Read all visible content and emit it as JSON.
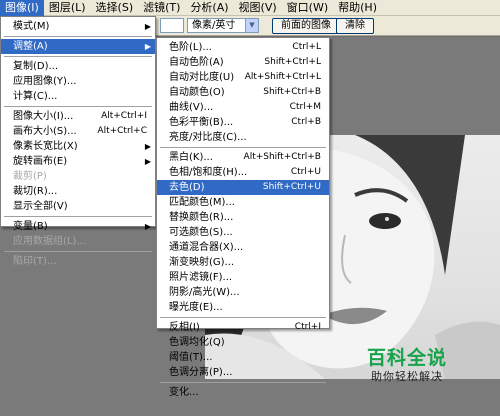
{
  "menubar": {
    "items": [
      "图像(I)",
      "图层(L)",
      "选择(S)",
      "滤镜(T)",
      "分析(A)",
      "视图(V)",
      "窗口(W)",
      "帮助(H)"
    ]
  },
  "options_bar": {
    "unit_select": "像素/英寸",
    "front_image_button": "前面的图像",
    "clear_button": "清除"
  },
  "image_menu": {
    "items": [
      {
        "label": "模式(M)",
        "submenu": true
      },
      {
        "label": "调整(A)",
        "submenu": true,
        "active": true
      },
      {
        "label": "复制(D)..."
      },
      {
        "label": "应用图像(Y)..."
      },
      {
        "label": "计算(C)..."
      },
      {
        "label": "图像大小(I)...",
        "shortcut": "Alt+Ctrl+I"
      },
      {
        "label": "画布大小(S)...",
        "shortcut": "Alt+Ctrl+C"
      },
      {
        "label": "像素长宽比(X)",
        "submenu": true
      },
      {
        "label": "旋转画布(E)",
        "submenu": true
      },
      {
        "label": "裁剪(P)",
        "disabled": true
      },
      {
        "label": "裁切(R)..."
      },
      {
        "label": "显示全部(V)"
      },
      {
        "label": "变量(B)",
        "submenu": true
      },
      {
        "label": "应用数据组(L)...",
        "disabled": true
      },
      {
        "label": "陷印(T)...",
        "disabled": true
      }
    ]
  },
  "adjust_submenu": {
    "items": [
      {
        "label": "色阶(L)...",
        "shortcut": "Ctrl+L"
      },
      {
        "label": "自动色阶(A)",
        "shortcut": "Shift+Ctrl+L"
      },
      {
        "label": "自动对比度(U)",
        "shortcut": "Alt+Shift+Ctrl+L"
      },
      {
        "label": "自动颜色(O)",
        "shortcut": "Shift+Ctrl+B"
      },
      {
        "label": "曲线(V)...",
        "shortcut": "Ctrl+M"
      },
      {
        "label": "色彩平衡(B)...",
        "shortcut": "Ctrl+B"
      },
      {
        "label": "亮度/对比度(C)..."
      },
      {
        "label": "黑白(K)...",
        "shortcut": "Alt+Shift+Ctrl+B"
      },
      {
        "label": "色相/饱和度(H)...",
        "shortcut": "Ctrl+U"
      },
      {
        "label": "去色(D)",
        "shortcut": "Shift+Ctrl+U",
        "highlighted": true
      },
      {
        "label": "匹配颜色(M)..."
      },
      {
        "label": "替换颜色(R)..."
      },
      {
        "label": "可选颜色(S)..."
      },
      {
        "label": "通道混合器(X)..."
      },
      {
        "label": "渐变映射(G)..."
      },
      {
        "label": "照片滤镜(F)..."
      },
      {
        "label": "阴影/高光(W)..."
      },
      {
        "label": "曝光度(E)..."
      },
      {
        "label": "反相(I)",
        "shortcut": "Ctrl+I"
      },
      {
        "label": "色调均化(Q)"
      },
      {
        "label": "阈值(T)..."
      },
      {
        "label": "色调分离(P)..."
      },
      {
        "label": "变化..."
      }
    ]
  },
  "watermark": {
    "title": "百科全说",
    "subtitle": "助你轻松解决"
  },
  "colors": {
    "menu_highlight": "#316ac5",
    "watermark_green": "#16a34a"
  }
}
